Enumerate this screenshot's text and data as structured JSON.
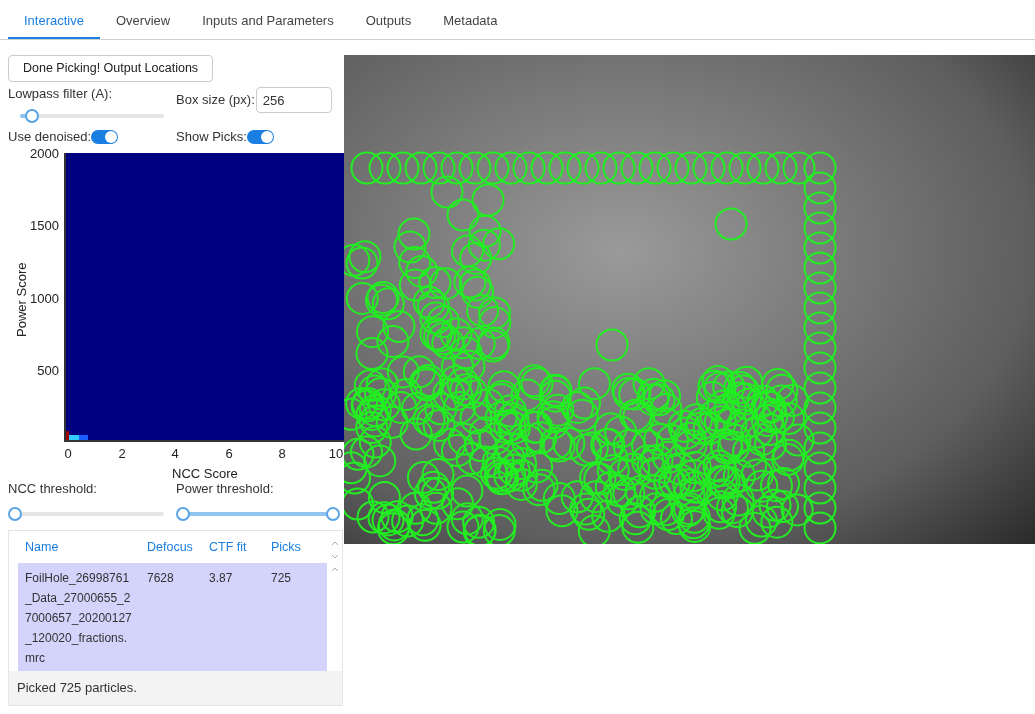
{
  "tabs": [
    {
      "label": "Interactive",
      "selected": true
    },
    {
      "label": "Overview",
      "selected": false
    },
    {
      "label": "Inputs and Parameters",
      "selected": false
    },
    {
      "label": "Outputs",
      "selected": false
    },
    {
      "label": "Metadata",
      "selected": false
    }
  ],
  "output_button": "Done Picking! Output Locations",
  "lowpass": {
    "label": "Lowpass filter (A):",
    "level": 0.08
  },
  "box_size": {
    "label": "Box size (px):",
    "value": "256"
  },
  "use_denoised": {
    "label": "Use denoised:",
    "on": true
  },
  "show_picks": {
    "label": "Show Picks:",
    "on": true
  },
  "histogram": {
    "ylabel": "Power Score",
    "xlabel": "NCC Score",
    "yticks": [
      "2000",
      "1500",
      "1000",
      "500"
    ],
    "xticks": [
      "0",
      "2",
      "4",
      "6",
      "8",
      "10"
    ]
  },
  "ncc_threshold": {
    "label": "NCC threshold:",
    "level": 0
  },
  "power_threshold": {
    "label": "Power threshold:",
    "thumbs": [
      {
        "level": 0
      },
      {
        "level": 1
      }
    ]
  },
  "table": {
    "columns": [
      "Name",
      "Defocus",
      "CTF fit",
      "Picks"
    ],
    "rows": [
      {
        "cells": [
          "FoilHole_26998761_Data_27000655_27000657_20200127_120020_fractions.mrc",
          "7628",
          "3.87",
          "725"
        ],
        "selected": true
      }
    ]
  },
  "status": "Picked 725 particles."
}
